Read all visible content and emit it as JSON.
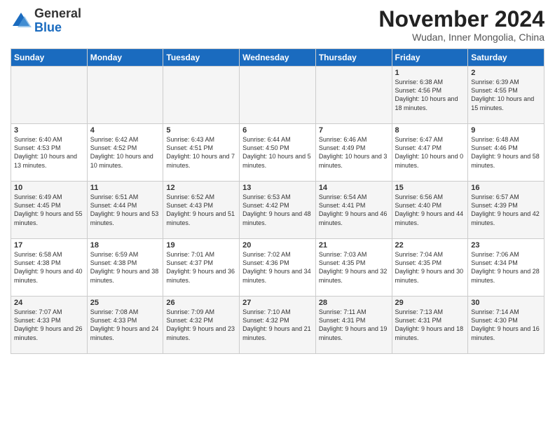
{
  "logo": {
    "general": "General",
    "blue": "Blue"
  },
  "title": "November 2024",
  "subtitle": "Wudan, Inner Mongolia, China",
  "days_header": [
    "Sunday",
    "Monday",
    "Tuesday",
    "Wednesday",
    "Thursday",
    "Friday",
    "Saturday"
  ],
  "weeks": [
    [
      {
        "day": "",
        "info": ""
      },
      {
        "day": "",
        "info": ""
      },
      {
        "day": "",
        "info": ""
      },
      {
        "day": "",
        "info": ""
      },
      {
        "day": "",
        "info": ""
      },
      {
        "day": "1",
        "info": "Sunrise: 6:38 AM\nSunset: 4:56 PM\nDaylight: 10 hours and 18 minutes."
      },
      {
        "day": "2",
        "info": "Sunrise: 6:39 AM\nSunset: 4:55 PM\nDaylight: 10 hours and 15 minutes."
      }
    ],
    [
      {
        "day": "3",
        "info": "Sunrise: 6:40 AM\nSunset: 4:53 PM\nDaylight: 10 hours and 13 minutes."
      },
      {
        "day": "4",
        "info": "Sunrise: 6:42 AM\nSunset: 4:52 PM\nDaylight: 10 hours and 10 minutes."
      },
      {
        "day": "5",
        "info": "Sunrise: 6:43 AM\nSunset: 4:51 PM\nDaylight: 10 hours and 7 minutes."
      },
      {
        "day": "6",
        "info": "Sunrise: 6:44 AM\nSunset: 4:50 PM\nDaylight: 10 hours and 5 minutes."
      },
      {
        "day": "7",
        "info": "Sunrise: 6:46 AM\nSunset: 4:49 PM\nDaylight: 10 hours and 3 minutes."
      },
      {
        "day": "8",
        "info": "Sunrise: 6:47 AM\nSunset: 4:47 PM\nDaylight: 10 hours and 0 minutes."
      },
      {
        "day": "9",
        "info": "Sunrise: 6:48 AM\nSunset: 4:46 PM\nDaylight: 9 hours and 58 minutes."
      }
    ],
    [
      {
        "day": "10",
        "info": "Sunrise: 6:49 AM\nSunset: 4:45 PM\nDaylight: 9 hours and 55 minutes."
      },
      {
        "day": "11",
        "info": "Sunrise: 6:51 AM\nSunset: 4:44 PM\nDaylight: 9 hours and 53 minutes."
      },
      {
        "day": "12",
        "info": "Sunrise: 6:52 AM\nSunset: 4:43 PM\nDaylight: 9 hours and 51 minutes."
      },
      {
        "day": "13",
        "info": "Sunrise: 6:53 AM\nSunset: 4:42 PM\nDaylight: 9 hours and 48 minutes."
      },
      {
        "day": "14",
        "info": "Sunrise: 6:54 AM\nSunset: 4:41 PM\nDaylight: 9 hours and 46 minutes."
      },
      {
        "day": "15",
        "info": "Sunrise: 6:56 AM\nSunset: 4:40 PM\nDaylight: 9 hours and 44 minutes."
      },
      {
        "day": "16",
        "info": "Sunrise: 6:57 AM\nSunset: 4:39 PM\nDaylight: 9 hours and 42 minutes."
      }
    ],
    [
      {
        "day": "17",
        "info": "Sunrise: 6:58 AM\nSunset: 4:38 PM\nDaylight: 9 hours and 40 minutes."
      },
      {
        "day": "18",
        "info": "Sunrise: 6:59 AM\nSunset: 4:38 PM\nDaylight: 9 hours and 38 minutes."
      },
      {
        "day": "19",
        "info": "Sunrise: 7:01 AM\nSunset: 4:37 PM\nDaylight: 9 hours and 36 minutes."
      },
      {
        "day": "20",
        "info": "Sunrise: 7:02 AM\nSunset: 4:36 PM\nDaylight: 9 hours and 34 minutes."
      },
      {
        "day": "21",
        "info": "Sunrise: 7:03 AM\nSunset: 4:35 PM\nDaylight: 9 hours and 32 minutes."
      },
      {
        "day": "22",
        "info": "Sunrise: 7:04 AM\nSunset: 4:35 PM\nDaylight: 9 hours and 30 minutes."
      },
      {
        "day": "23",
        "info": "Sunrise: 7:06 AM\nSunset: 4:34 PM\nDaylight: 9 hours and 28 minutes."
      }
    ],
    [
      {
        "day": "24",
        "info": "Sunrise: 7:07 AM\nSunset: 4:33 PM\nDaylight: 9 hours and 26 minutes."
      },
      {
        "day": "25",
        "info": "Sunrise: 7:08 AM\nSunset: 4:33 PM\nDaylight: 9 hours and 24 minutes."
      },
      {
        "day": "26",
        "info": "Sunrise: 7:09 AM\nSunset: 4:32 PM\nDaylight: 9 hours and 23 minutes."
      },
      {
        "day": "27",
        "info": "Sunrise: 7:10 AM\nSunset: 4:32 PM\nDaylight: 9 hours and 21 minutes."
      },
      {
        "day": "28",
        "info": "Sunrise: 7:11 AM\nSunset: 4:31 PM\nDaylight: 9 hours and 19 minutes."
      },
      {
        "day": "29",
        "info": "Sunrise: 7:13 AM\nSunset: 4:31 PM\nDaylight: 9 hours and 18 minutes."
      },
      {
        "day": "30",
        "info": "Sunrise: 7:14 AM\nSunset: 4:30 PM\nDaylight: 9 hours and 16 minutes."
      }
    ]
  ]
}
